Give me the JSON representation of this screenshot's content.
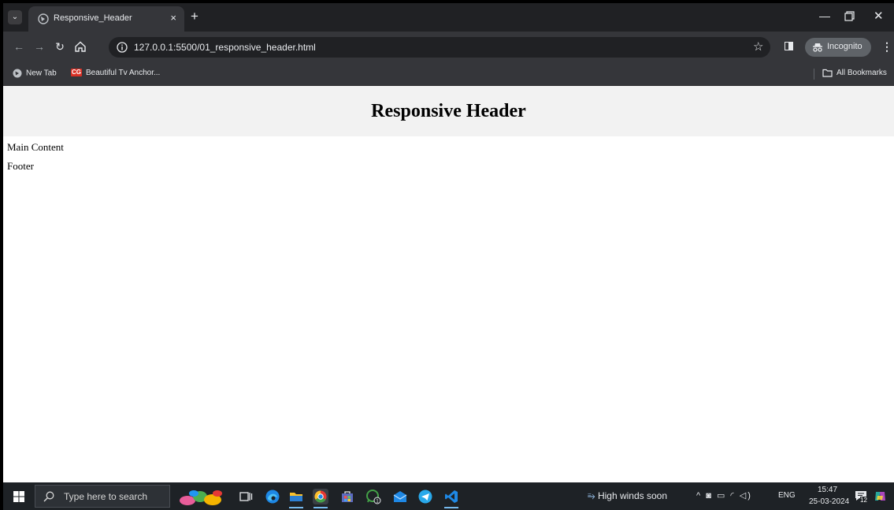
{
  "browser": {
    "tab_title": "Responsive_Header",
    "tab_close": "×",
    "new_tab": "+",
    "url": "127.0.0.1:5500/01_responsive_header.html",
    "incognito_label": "Incognito",
    "window_min": "—",
    "window_close": "✕",
    "menu_glyph": "⋮"
  },
  "bookmarks": {
    "items": [
      {
        "label": "New Tab",
        "icon": "chrome-icon"
      },
      {
        "label": "Beautiful Tv Anchor...",
        "icon": "cg-icon",
        "icon_text": "CG"
      }
    ],
    "all_bookmarks": "All Bookmarks"
  },
  "page": {
    "header_title": "Responsive Header",
    "main_content": "Main Content",
    "footer": "Footer",
    "header_bg": "#f2f2f2"
  },
  "taskbar": {
    "search_placeholder": "Type here to search",
    "weather": "High winds soon",
    "language": "ENG",
    "time": "15:47",
    "date": "25-03-2024",
    "notification_count": "12"
  }
}
